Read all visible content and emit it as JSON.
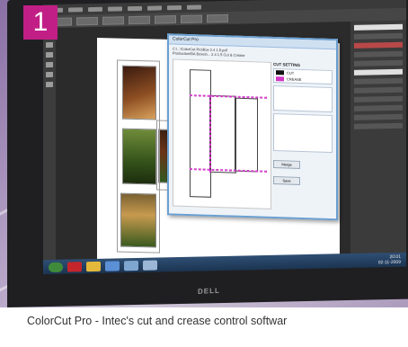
{
  "badge": {
    "number": "1",
    "color": "#c21f86"
  },
  "caption": {
    "text": "ColorCut Pro - Intec's cut and crease control softwar"
  },
  "monitor": {
    "brand": "DELL"
  },
  "dialog": {
    "title": "ColorCut Pro",
    "path_line1": "C:\\...\\ColorCut Pro\\Box 2.4 1.5.pdf",
    "path_line2": "Production\\BA Boxes\\... 2.4 1.5 Cut & Crease",
    "cut_setting_title": "CUT SETTING",
    "swatches": [
      {
        "label": "CUT",
        "color": "#111111"
      },
      {
        "label": "CREASE",
        "color": "#d236c8"
      }
    ],
    "buttons": [
      "Merge",
      "Save"
    ],
    "colors": {
      "cut": "#111111",
      "crease": "#d236c8",
      "frame": "#6a9fd1"
    }
  },
  "taskbar": {
    "time": "20:01",
    "date": "02-11-2009"
  }
}
